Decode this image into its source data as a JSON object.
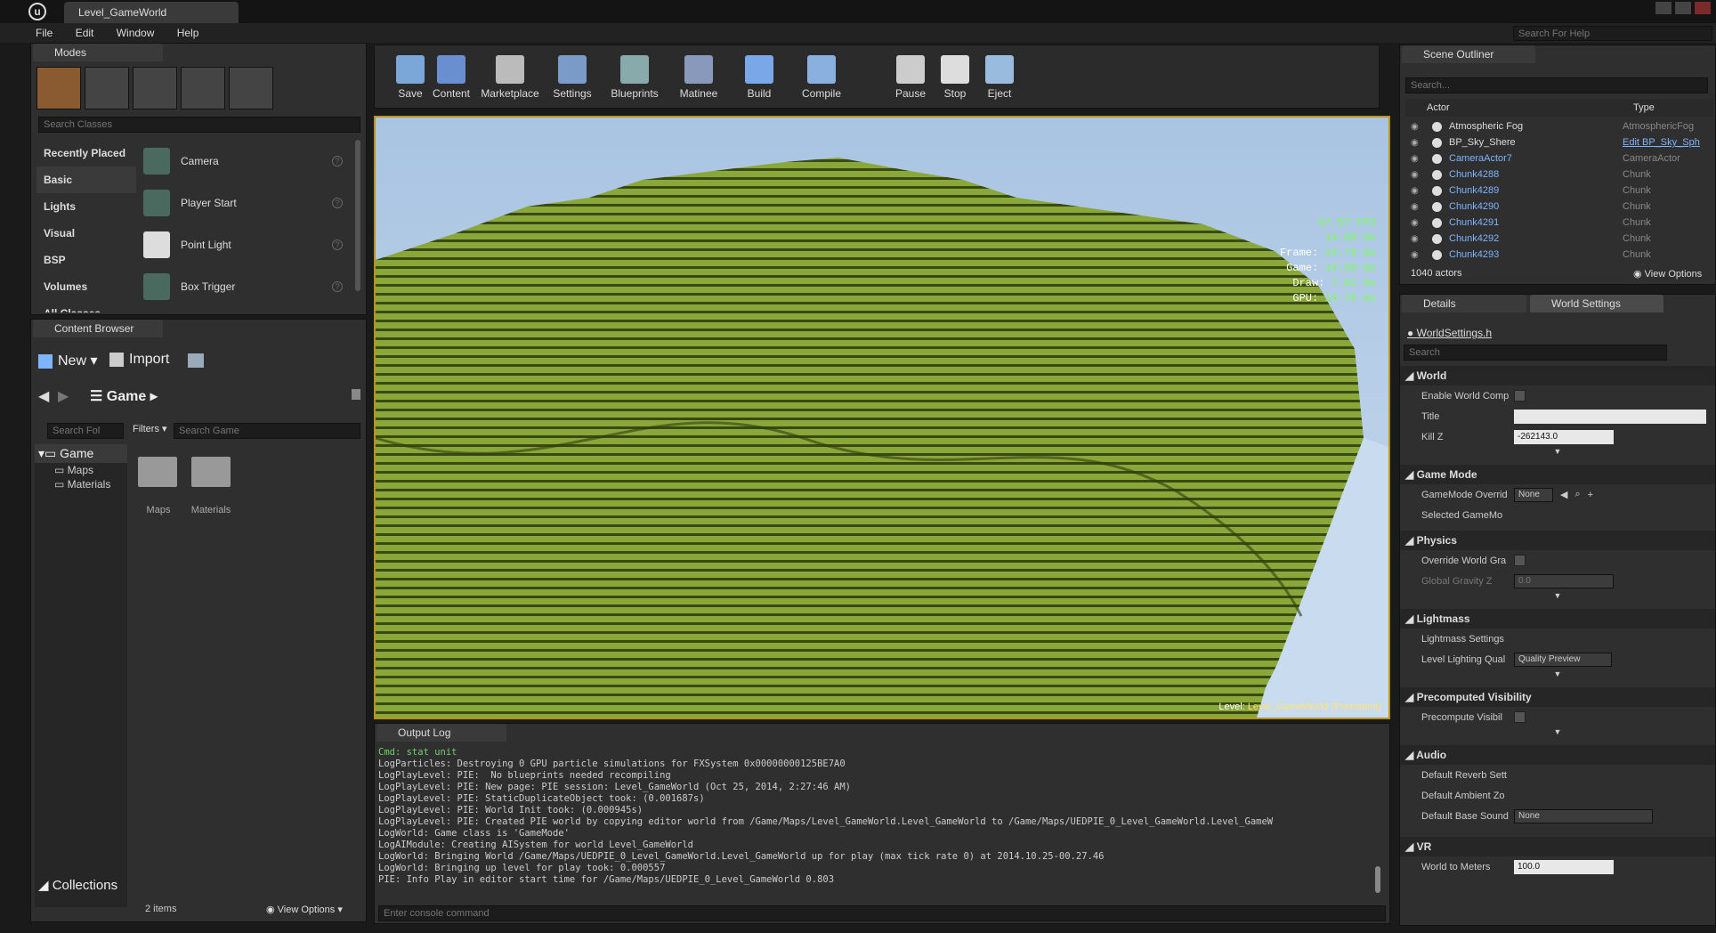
{
  "window": {
    "tab_title": "Level_GameWorld",
    "help_search_placeholder": "Search For Help"
  },
  "menu": [
    "File",
    "Edit",
    "Window",
    "Help"
  ],
  "modes": {
    "tab": "Modes",
    "search_placeholder": "Search Classes",
    "categories": [
      "Recently Placed",
      "Basic",
      "Lights",
      "Visual",
      "BSP",
      "Volumes",
      "All Classes"
    ],
    "items": [
      {
        "label": "Camera"
      },
      {
        "label": "Player Start"
      },
      {
        "label": "Point Light"
      },
      {
        "label": "Box Trigger"
      }
    ]
  },
  "toolbar": [
    {
      "label": "Save",
      "icon": "save-icon"
    },
    {
      "label": "Content",
      "icon": "content-icon"
    },
    {
      "label": "Marketplace",
      "icon": "marketplace-icon"
    },
    {
      "label": "Settings",
      "icon": "settings-icon"
    },
    {
      "label": "Blueprints",
      "icon": "blueprints-icon"
    },
    {
      "label": "Matinee",
      "icon": "matinee-icon"
    },
    {
      "label": "Build",
      "icon": "build-icon"
    },
    {
      "label": "Compile",
      "icon": "compile-icon"
    },
    {
      "label": "Pause",
      "icon": "pause-icon"
    },
    {
      "label": "Stop",
      "icon": "stop-icon"
    },
    {
      "label": "Eject",
      "icon": "eject-icon"
    }
  ],
  "viewport": {
    "stats": {
      "fps": "67.57 FPS",
      "ms": "14.80 ms",
      "frame_label": "Frame:",
      "frame": "14.76 ms",
      "game_label": "Game:",
      "game": "14.69 ms",
      "draw_label": "Draw:",
      "draw": "7.01 ms",
      "gpu_label": "GPU:",
      "gpu": "14.75 ms"
    },
    "level_label": "Level:",
    "level_name": "Level_GameWorld (Persistent)"
  },
  "content_browser": {
    "tab": "Content Browser",
    "new_label": "New",
    "import_label": "Import",
    "path": "Game",
    "folder_search": "Search Fol",
    "filters": "Filters",
    "search_game": "Search Game",
    "tree_root": "Game",
    "tree": [
      "Maps",
      "Materials"
    ],
    "folders": [
      "Maps",
      "Materials"
    ],
    "collections": "Collections",
    "count": "2 items",
    "view_options": "View Options"
  },
  "output_log": {
    "tab": "Output Log",
    "lines": [
      "Cmd: stat unit",
      "LogParticles: Destroying 0 GPU particle simulations for FXSystem 0x00000000125BE7A0",
      "LogPlayLevel: PIE:  No blueprints needed recompiling",
      "LogPlayLevel: PIE: New page: PIE session: Level_GameWorld (Oct 25, 2014, 2:27:46 AM)",
      "LogPlayLevel: PIE: StaticDuplicateObject took: (0.001687s)",
      "LogPlayLevel: PIE: World Init took: (0.000945s)",
      "LogPlayLevel: PIE: Created PIE world by copying editor world from /Game/Maps/Level_GameWorld.Level_GameWorld to /Game/Maps/UEDPIE_0_Level_GameWorld.Level_GameW",
      "LogWorld: Game class is 'GameMode'",
      "LogAIModule: Creating AISystem for world Level_GameWorld",
      "LogWorld: Bringing World /Game/Maps/UEDPIE_0_Level_GameWorld.Level_GameWorld up for play (max tick rate 0) at 2014.10.25-00.27.46",
      "LogWorld: Bringing up level for play took: 0.000557",
      "PIE: Info Play in editor start time for /Game/Maps/UEDPIE_0_Level_GameWorld 0.803"
    ],
    "console_placeholder": "Enter console command"
  },
  "outliner": {
    "tab": "Scene Outliner",
    "search_placeholder": "Search...",
    "col_actor": "Actor",
    "col_type": "Type",
    "rows": [
      {
        "name": "Atmospheric Fog",
        "type": "AtmosphericFog",
        "link": false
      },
      {
        "name": "BP_Sky_Shere",
        "type": "Edit BP_Sky_Sph",
        "link": false,
        "type_link": true
      },
      {
        "name": "CameraActor7",
        "type": "CameraActor",
        "link": true
      },
      {
        "name": "Chunk4288",
        "type": "Chunk",
        "link": true
      },
      {
        "name": "Chunk4289",
        "type": "Chunk",
        "link": true
      },
      {
        "name": "Chunk4290",
        "type": "Chunk",
        "link": true
      },
      {
        "name": "Chunk4291",
        "type": "Chunk",
        "link": true
      },
      {
        "name": "Chunk4292",
        "type": "Chunk",
        "link": true
      },
      {
        "name": "Chunk4293",
        "type": "Chunk",
        "link": true
      }
    ],
    "count": "1040 actors",
    "view_options": "View Options"
  },
  "details": {
    "tab_details": "Details",
    "tab_world": "World Settings",
    "object": "WorldSettings.h",
    "search_placeholder": "Search",
    "world": {
      "title": "World",
      "enable": "Enable World Comp",
      "title_lbl": "Title",
      "killz": "Kill Z",
      "killz_val": "-262143.0"
    },
    "gamemode": {
      "title": "Game Mode",
      "override": "GameMode Overrid",
      "override_val": "None",
      "selected": "Selected GameMo"
    },
    "physics": {
      "title": "Physics",
      "override": "Override World Gra",
      "gravity": "Global Gravity Z",
      "gravity_val": "0.0"
    },
    "lightmass": {
      "title": "Lightmass",
      "settings": "Lightmass Settings",
      "quality": "Level Lighting Qual",
      "quality_val": "Quality Preview"
    },
    "precomputed": {
      "title": "Precomputed Visibility",
      "vis": "Precompute Visibil"
    },
    "audio": {
      "title": "Audio",
      "reverb": "Default Reverb Sett",
      "ambient": "Default Ambient Zo",
      "sound": "Default Base Sound",
      "sound_val": "None"
    },
    "vr": {
      "title": "VR",
      "meters": "World to Meters",
      "meters_val": "100.0"
    }
  }
}
